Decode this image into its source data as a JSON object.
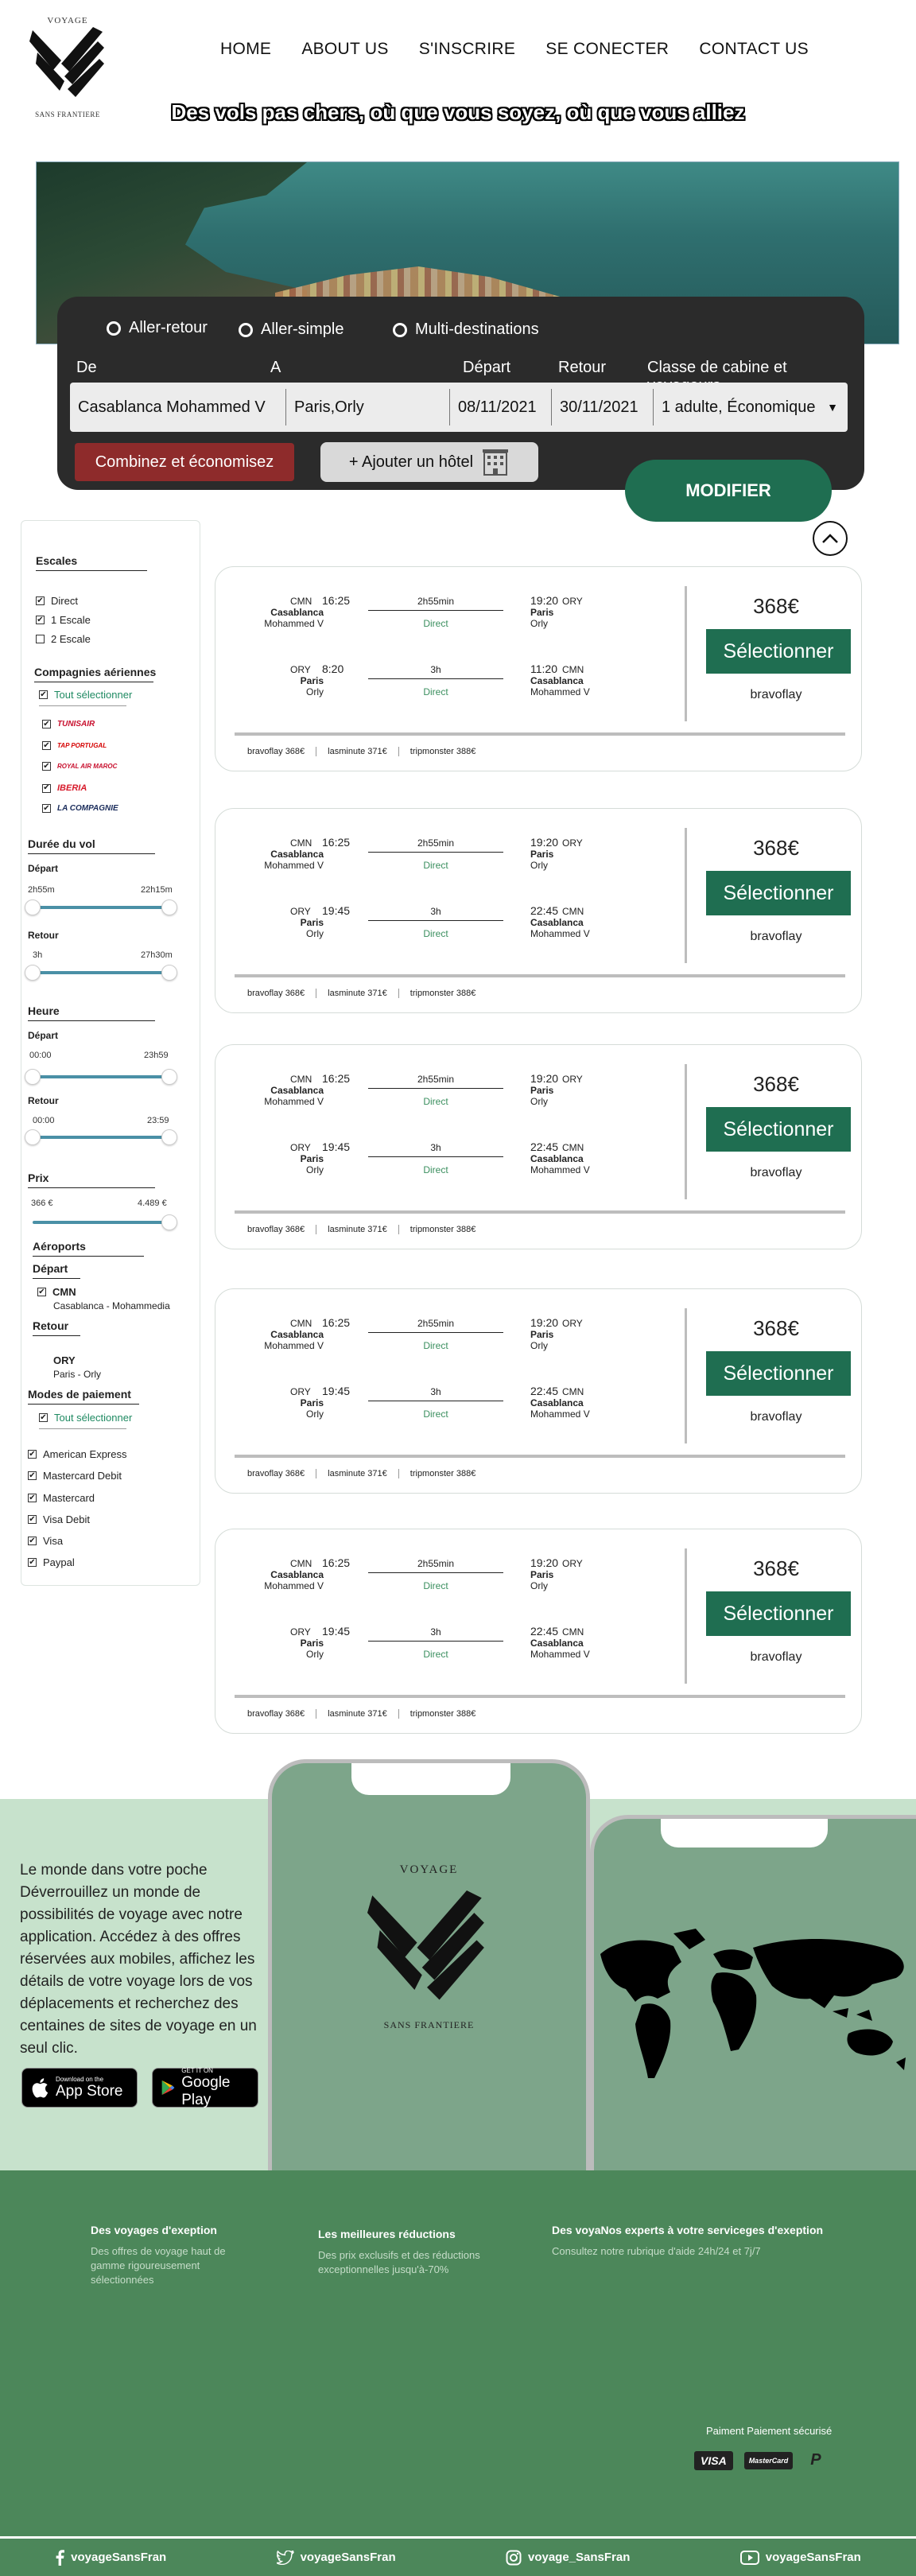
{
  "logo": {
    "top_text": "VOYAGE",
    "bottom_text": "SANS FRANTIERE"
  },
  "nav": [
    "HOME",
    "ABOUT US",
    "S'INSCRIRE",
    "SE CONECTER",
    "CONTACT US"
  ],
  "tagline": "Des vols pas chers, où que vous soyez, où que vous alliez",
  "search": {
    "trip_types": [
      "Aller-retour",
      "Aller-simple",
      "Multi-destinations"
    ],
    "labels": {
      "from": "De",
      "to": "A",
      "depart": "Départ",
      "return": "Retour",
      "cabin": "Classe de cabine et voyageurs"
    },
    "values": {
      "from": "Casablanca Mohammed V",
      "to": "Paris,Orly",
      "depart": "08/11/2021",
      "return": "30/11/2021",
      "cabin": "1 adulte, Économique"
    },
    "combine_label": "Combinez et économisez",
    "hotel_label": "+ Ajouter un hôtel",
    "modify_label": "MODIFIER"
  },
  "sidebar": {
    "stops_title": "Escales",
    "stops": [
      {
        "label": "Direct",
        "checked": true
      },
      {
        "label": "1 Escale",
        "checked": true
      },
      {
        "label": "2 Escale",
        "checked": false
      }
    ],
    "airlines_title": "Compagnies aériennes",
    "select_all": "Tout sélectionner",
    "airlines": [
      "TUNISAIR",
      "TAP PORTUGAL",
      "ROYAL AIR MAROC",
      "IBERIA",
      "LA COMPAGNIE"
    ],
    "duration_title": "Durée du vol",
    "duration_depart_label": "Départ",
    "duration_depart_range": [
      "2h55m",
      "22h15m"
    ],
    "duration_return_label": "Retour",
    "duration_return_range": [
      "3h",
      "27h30m"
    ],
    "hour_title": "Heure",
    "hour_depart_label": "Départ",
    "hour_depart_range": [
      "00:00",
      "23h59"
    ],
    "hour_return_label": "Retour",
    "hour_return_range": [
      "00:00",
      "23:59"
    ],
    "price_title": "Prix",
    "price_range": [
      "366 €",
      "4.489 €"
    ],
    "airports_title": "Aéroports",
    "airports_depart_label": "Départ",
    "airport_depart_code": "CMN",
    "airport_depart_name": "Casablanca - Mohammedia",
    "airports_return_label": "Retour",
    "airport_return_code": "ORY",
    "airport_return_name": "Paris - Orly",
    "payment_title": "Modes de paiement",
    "payment_select_all": "Tout sélectionner",
    "payments": [
      "American Express",
      "Mastercard Debit",
      "Mastercard",
      "Visa Debit",
      "Visa",
      "Paypal"
    ]
  },
  "results": [
    {
      "outbound": {
        "from_code": "CMN",
        "dep_time": "16:25",
        "from_city": "Casablanca",
        "from_airport": "Mohammed V",
        "duration": "2h55min",
        "type": "Direct",
        "arr_time": "19:20",
        "to_code": "ORY",
        "to_city": "Paris",
        "to_airport": "Orly"
      },
      "inbound": {
        "from_code": "ORY",
        "dep_time": "8:20",
        "from_city": "Paris",
        "from_airport": "Orly",
        "duration": "3h",
        "type": "Direct",
        "arr_time": "11:20",
        "to_code": "CMN",
        "to_city": "Casablanca",
        "to_airport": "Mohammed V"
      },
      "price": "368€",
      "select_label": "Sélectionner",
      "provider": "bravoflay",
      "offers": [
        "bravoflay  368€",
        "lasminute  371€",
        "tripmonster  388€"
      ]
    },
    {
      "outbound": {
        "from_code": "CMN",
        "dep_time": "16:25",
        "from_city": "Casablanca",
        "from_airport": "Mohammed V",
        "duration": "2h55min",
        "type": "Direct",
        "arr_time": "19:20",
        "to_code": "ORY",
        "to_city": "Paris",
        "to_airport": "Orly"
      },
      "inbound": {
        "from_code": "ORY",
        "dep_time": "19:45",
        "from_city": "Paris",
        "from_airport": "Orly",
        "duration": "3h",
        "type": "Direct",
        "arr_time": "22:45",
        "to_code": "CMN",
        "to_city": "Casablanca",
        "to_airport": "Mohammed V"
      },
      "price": "368€",
      "select_label": "Sélectionner",
      "provider": "bravoflay",
      "offers": [
        "bravoflay  368€",
        "lasminute  371€",
        "tripmonster  388€"
      ]
    },
    {
      "outbound": {
        "from_code": "CMN",
        "dep_time": "16:25",
        "from_city": "Casablanca",
        "from_airport": "Mohammed V",
        "duration": "2h55min",
        "type": "Direct",
        "arr_time": "19:20",
        "to_code": "ORY",
        "to_city": "Paris",
        "to_airport": "Orly"
      },
      "inbound": {
        "from_code": "ORY",
        "dep_time": "19:45",
        "from_city": "Paris",
        "from_airport": "Orly",
        "duration": "3h",
        "type": "Direct",
        "arr_time": "22:45",
        "to_code": "CMN",
        "to_city": "Casablanca",
        "to_airport": "Mohammed V"
      },
      "price": "368€",
      "select_label": "Sélectionner",
      "provider": "bravoflay",
      "offers": [
        "bravoflay  368€",
        "lasminute  371€",
        "tripmonster  388€"
      ]
    },
    {
      "outbound": {
        "from_code": "CMN",
        "dep_time": "16:25",
        "from_city": "Casablanca",
        "from_airport": "Mohammed V",
        "duration": "2h55min",
        "type": "Direct",
        "arr_time": "19:20",
        "to_code": "ORY",
        "to_city": "Paris",
        "to_airport": "Orly"
      },
      "inbound": {
        "from_code": "ORY",
        "dep_time": "19:45",
        "from_city": "Paris",
        "from_airport": "Orly",
        "duration": "3h",
        "type": "Direct",
        "arr_time": "22:45",
        "to_code": "CMN",
        "to_city": "Casablanca",
        "to_airport": "Mohammed V"
      },
      "price": "368€",
      "select_label": "Sélectionner",
      "provider": "bravoflay",
      "offers": [
        "bravoflay  368€",
        "lasminute  371€",
        "tripmonster  388€"
      ]
    },
    {
      "outbound": {
        "from_code": "CMN",
        "dep_time": "16:25",
        "from_city": "Casablanca",
        "from_airport": "Mohammed V",
        "duration": "2h55min",
        "type": "Direct",
        "arr_time": "19:20",
        "to_code": "ORY",
        "to_city": "Paris",
        "to_airport": "Orly"
      },
      "inbound": {
        "from_code": "ORY",
        "dep_time": "19:45",
        "from_city": "Paris",
        "from_airport": "Orly",
        "duration": "3h",
        "type": "Direct",
        "arr_time": "22:45",
        "to_code": "CMN",
        "to_city": "Casablanca",
        "to_airport": "Mohammed V"
      },
      "price": "368€",
      "select_label": "Sélectionner",
      "provider": "bravoflay",
      "offers": [
        "bravoflay  368€",
        "lasminute  371€",
        "tripmonster  388€"
      ]
    }
  ],
  "promo": {
    "text": "Le monde dans votre poche Déverrouillez un monde de possibilités de voyage avec notre application. Accédez à des offres réservées aux mobiles, affichez les détails de votre voyage lors de vos déplacements et recherchez des centaines de sites de voyage en un seul clic.",
    "appstore_small": "Download on the",
    "appstore_big": "App Store",
    "googleplay_small": "GET IT ON",
    "googleplay_big": "Google Play",
    "phone_logo_top": "VOYAGE",
    "phone_logo_bottom": "SANS FRANTIERE"
  },
  "footer": {
    "col1_title": "Des voyages d'exeption",
    "col1_text": "Des offres de voyage haut de gamme rigoureusement sélectionnées",
    "col2_title": "Les meilleures réductions",
    "col2_text": "Des prix exclusifs et des réductions exceptionnelles jusqu'à-70%",
    "col3_title": "Des voyaNos experts à votre serviceges d'exeption",
    "col3_text": "Consultez notre rubrique d'aide 24h/24 et 7j/7",
    "payment_title": "Paiment Paiement sécurisé",
    "payment_logos": [
      "VISA",
      "MasterCard",
      "P"
    ]
  },
  "social": {
    "facebook": "voyageSansFran",
    "twitter": "voyageSansFran",
    "instagram": "voyage_SansFran",
    "youtube": "voyageSansFran"
  },
  "colors": {
    "brand_green": "#1f6e51",
    "footer_green": "#4c875a",
    "promo_bg": "#c7e2cc",
    "combine_red": "#8e2b2b",
    "search_bg": "#2b2b2b"
  }
}
